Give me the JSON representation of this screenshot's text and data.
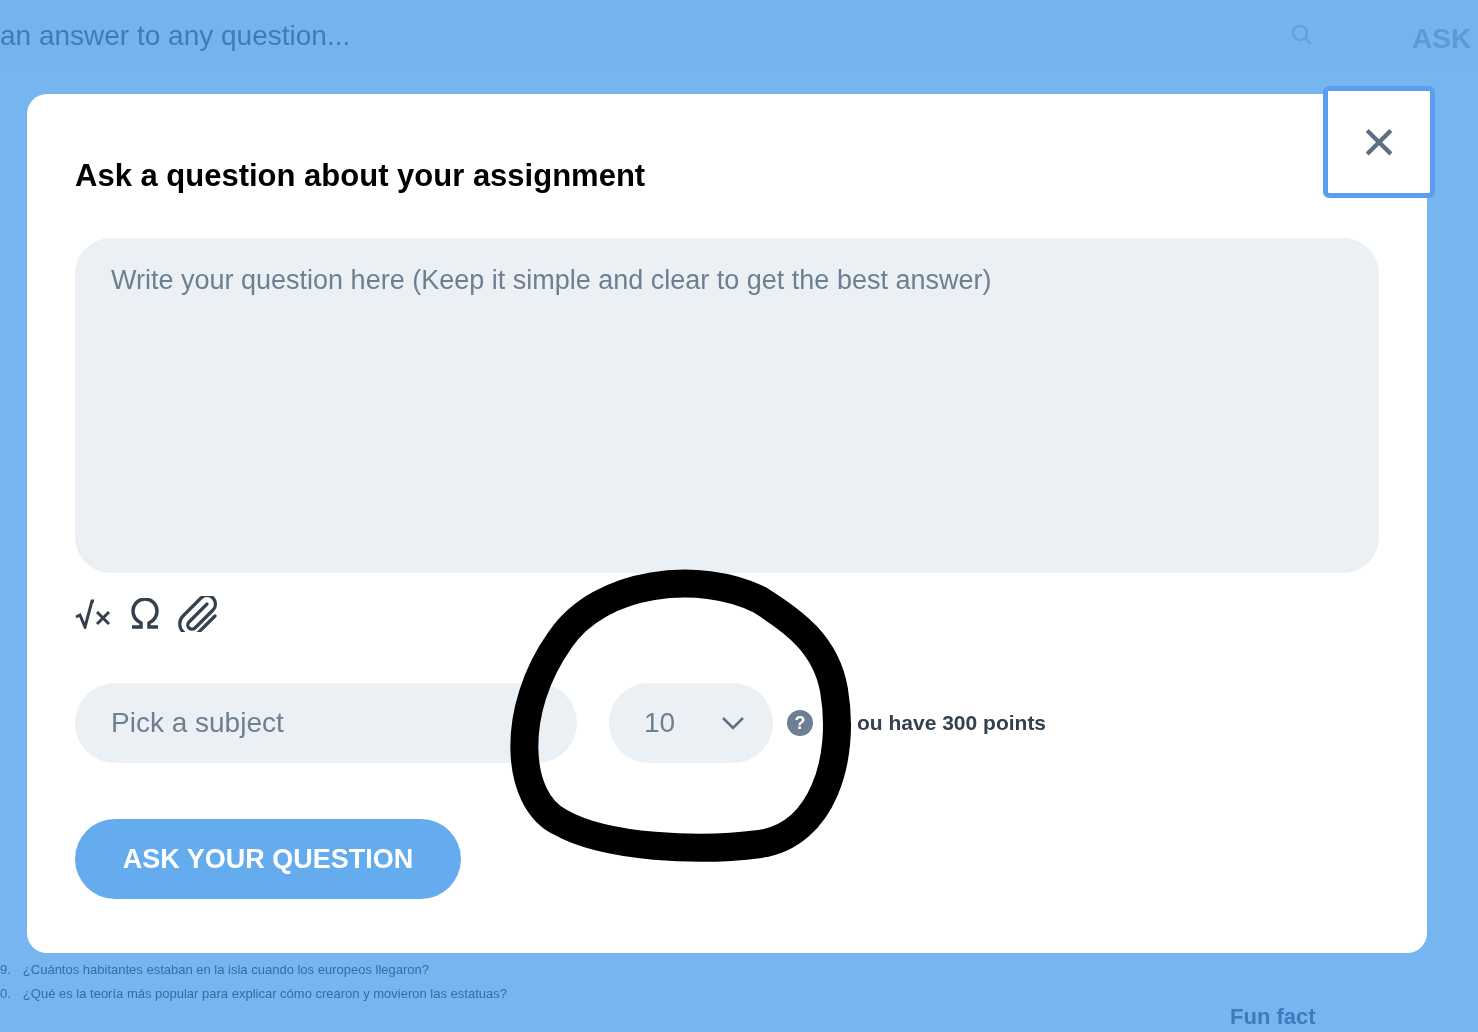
{
  "background": {
    "search_placeholder": "an answer to any question...",
    "ask_label": "ASK",
    "question_lines": [
      {
        "number": "9.",
        "text": "¿Cuántos habitantes estaban en la isla cuando los europeos llegaron?"
      },
      {
        "number": "0.",
        "text": "¿Qué es la teoría más popular para explicar cómo crearon y movieron las estatuas?"
      }
    ],
    "fun_fact": "Fun fact"
  },
  "dialog": {
    "title": "Ask a question about your assignment",
    "close": "×",
    "question_field": {
      "placeholder": "Write your question here (Keep it simple and clear to get the best answer)"
    },
    "tools": [
      {
        "kind": "equation"
      },
      {
        "kind": "symbol"
      },
      {
        "kind": "attachment"
      }
    ],
    "subject_select": {
      "placeholder": "Pick a subject"
    },
    "points_select": {
      "value": "10"
    },
    "points_help": "?",
    "points_note": "ou have 300 points",
    "submit": "ASK YOUR QUESTION"
  },
  "annotation": {
    "kind": "circle"
  }
}
